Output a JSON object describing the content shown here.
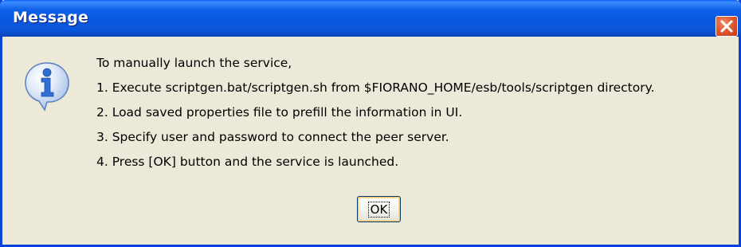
{
  "window": {
    "title": "Message"
  },
  "message": {
    "lines": [
      "To manually launch the service,",
      "1. Execute scriptgen.bat/scriptgen.sh from $FIORANO_HOME/esb/tools/scriptgen directory.",
      "2. Load saved properties file to prefill the information in UI.",
      "3. Specify user and password to connect the peer server.",
      "4. Press [OK] button and the service is launched."
    ]
  },
  "buttons": {
    "ok_label": "OK"
  },
  "icons": {
    "dialog_icon": "info-icon",
    "close": "close-icon"
  },
  "colors": {
    "titlebar": "#0a58df",
    "frame": "#0842d8",
    "dialog_background": "#ece9d8",
    "close_button": "#e05a33",
    "info_icon": "#2f6fd1"
  }
}
